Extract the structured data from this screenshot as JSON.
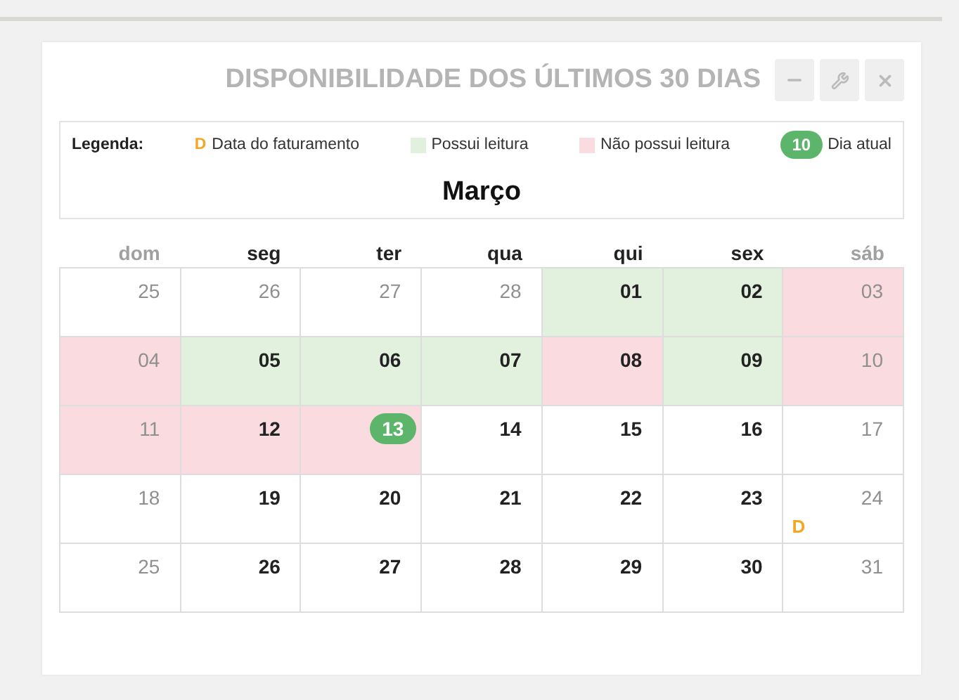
{
  "panel": {
    "title": "DISPONIBILIDADE DOS ÚLTIMOS 30 DIAS"
  },
  "legend": {
    "label": "Legenda:",
    "items": [
      {
        "kind": "billing",
        "mark": "D",
        "text": "Data do faturamento"
      },
      {
        "kind": "reading",
        "text": "Possui leitura"
      },
      {
        "kind": "no_reading",
        "text": "Não possui leitura"
      },
      {
        "kind": "today",
        "mark": "10",
        "text": "Dia atual"
      }
    ]
  },
  "month": "Março",
  "weekdays": [
    {
      "label": "dom",
      "weekend": true
    },
    {
      "label": "seg",
      "weekend": false
    },
    {
      "label": "ter",
      "weekend": false
    },
    {
      "label": "qua",
      "weekend": false
    },
    {
      "label": "qui",
      "weekend": false
    },
    {
      "label": "sex",
      "weekend": false
    },
    {
      "label": "sáb",
      "weekend": true
    }
  ],
  "weeks": [
    [
      {
        "day": "25",
        "muted": true,
        "kind": "plain",
        "today": false
      },
      {
        "day": "26",
        "muted": true,
        "kind": "plain",
        "today": false
      },
      {
        "day": "27",
        "muted": true,
        "kind": "plain",
        "today": false
      },
      {
        "day": "28",
        "muted": true,
        "kind": "plain",
        "today": false
      },
      {
        "day": "01",
        "muted": false,
        "kind": "reading",
        "today": false
      },
      {
        "day": "02",
        "muted": false,
        "kind": "reading",
        "today": false
      },
      {
        "day": "03",
        "muted": true,
        "kind": "no_reading",
        "today": false
      }
    ],
    [
      {
        "day": "04",
        "muted": true,
        "kind": "no_reading",
        "today": false
      },
      {
        "day": "05",
        "muted": false,
        "kind": "reading",
        "today": false
      },
      {
        "day": "06",
        "muted": false,
        "kind": "reading",
        "today": false
      },
      {
        "day": "07",
        "muted": false,
        "kind": "reading",
        "today": false
      },
      {
        "day": "08",
        "muted": false,
        "kind": "no_reading",
        "today": false
      },
      {
        "day": "09",
        "muted": false,
        "kind": "reading",
        "today": false
      },
      {
        "day": "10",
        "muted": true,
        "kind": "no_reading",
        "today": false
      }
    ],
    [
      {
        "day": "11",
        "muted": true,
        "kind": "no_reading",
        "today": false
      },
      {
        "day": "12",
        "muted": false,
        "kind": "no_reading",
        "today": false
      },
      {
        "day": "13",
        "muted": false,
        "kind": "no_reading",
        "today": true
      },
      {
        "day": "14",
        "muted": false,
        "kind": "plain",
        "today": false
      },
      {
        "day": "15",
        "muted": false,
        "kind": "plain",
        "today": false
      },
      {
        "day": "16",
        "muted": false,
        "kind": "plain",
        "today": false
      },
      {
        "day": "17",
        "muted": true,
        "kind": "plain",
        "today": false
      }
    ],
    [
      {
        "day": "18",
        "muted": true,
        "kind": "plain",
        "today": false
      },
      {
        "day": "19",
        "muted": false,
        "kind": "plain",
        "today": false
      },
      {
        "day": "20",
        "muted": false,
        "kind": "plain",
        "today": false
      },
      {
        "day": "21",
        "muted": false,
        "kind": "plain",
        "today": false
      },
      {
        "day": "22",
        "muted": false,
        "kind": "plain",
        "today": false
      },
      {
        "day": "23",
        "muted": false,
        "kind": "plain",
        "today": false
      },
      {
        "day": "24",
        "muted": true,
        "kind": "plain",
        "today": false,
        "billing": "D"
      }
    ],
    [
      {
        "day": "25",
        "muted": true,
        "kind": "plain",
        "today": false
      },
      {
        "day": "26",
        "muted": false,
        "kind": "plain",
        "today": false
      },
      {
        "day": "27",
        "muted": false,
        "kind": "plain",
        "today": false
      },
      {
        "day": "28",
        "muted": false,
        "kind": "plain",
        "today": false
      },
      {
        "day": "29",
        "muted": false,
        "kind": "plain",
        "today": false
      },
      {
        "day": "30",
        "muted": false,
        "kind": "plain",
        "today": false
      },
      {
        "day": "31",
        "muted": true,
        "kind": "plain",
        "today": false
      }
    ]
  ]
}
